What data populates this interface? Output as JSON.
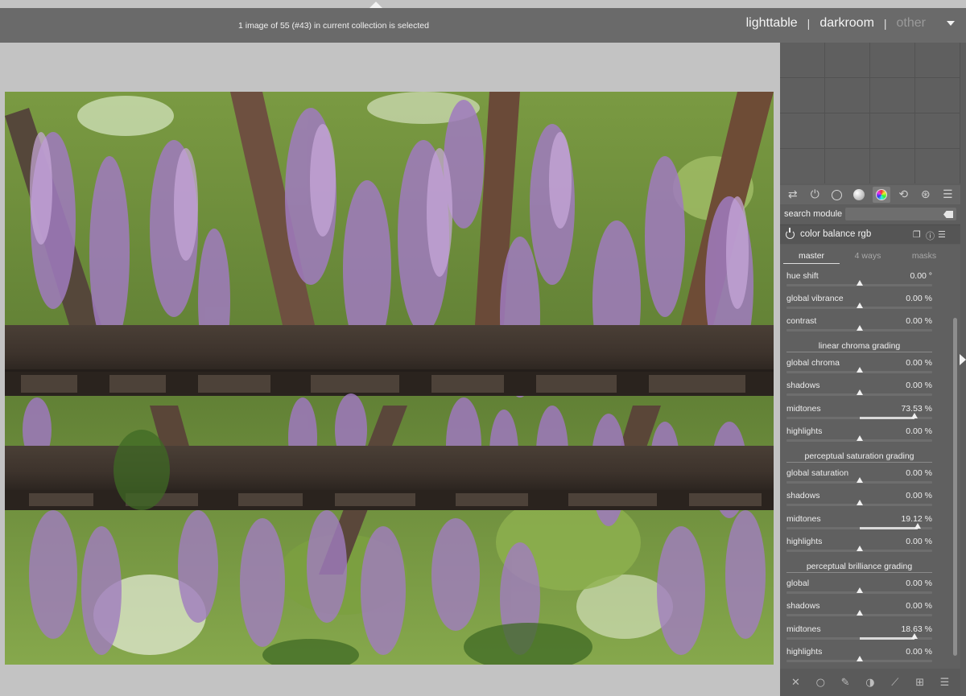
{
  "header": {
    "selection_info": "1 image of 55 (#43) in current collection is selected",
    "views": {
      "lighttable": "lighttable",
      "darkroom": "darkroom",
      "other": "other"
    },
    "separator": "|"
  },
  "module_groups": [
    {
      "icon": "sliders-icon",
      "glyph": "⇄"
    },
    {
      "icon": "power-icon",
      "glyph": "⏻"
    },
    {
      "icon": "ring-icon",
      "glyph": ""
    },
    {
      "icon": "sphere-icon",
      "glyph": ""
    },
    {
      "icon": "color-wheel-icon",
      "glyph": "",
      "active": true
    },
    {
      "icon": "circle-arrows-icon",
      "glyph": "⟲"
    },
    {
      "icon": "aperture-icon",
      "glyph": "⊛"
    },
    {
      "icon": "hamburger-icon",
      "glyph": "☰"
    }
  ],
  "search": {
    "label": "search module",
    "value": "",
    "placeholder": ""
  },
  "module": {
    "title": "color balance rgb",
    "tabs": [
      "master",
      "4 ways",
      "masks"
    ],
    "active_tab": "master"
  },
  "controls": {
    "hue_shift": {
      "label": "hue shift",
      "value": "0.00 °",
      "pos": 0.5
    },
    "global_vibrance": {
      "label": "global vibrance",
      "value": "0.00 %",
      "pos": 0.5
    },
    "contrast": {
      "label": "contrast",
      "value": "0.00 %",
      "pos": 0.5
    },
    "linear_chroma_grading": {
      "title": "linear chroma grading",
      "global_chroma": {
        "label": "global chroma",
        "value": "0.00 %",
        "pos": 0.5
      },
      "shadows": {
        "label": "shadows",
        "value": "0.00 %",
        "pos": 0.5
      },
      "midtones": {
        "label": "midtones",
        "value": "73.53 %",
        "pos": 0.88
      },
      "highlights": {
        "label": "highlights",
        "value": "0.00 %",
        "pos": 0.5
      }
    },
    "perceptual_saturation_grading": {
      "title": "perceptual saturation grading",
      "global_saturation": {
        "label": "global saturation",
        "value": "0.00 %",
        "pos": 0.5
      },
      "shadows": {
        "label": "shadows",
        "value": "0.00 %",
        "pos": 0.5
      },
      "midtones": {
        "label": "midtones",
        "value": "19.12 %",
        "pos": 0.9
      },
      "highlights": {
        "label": "highlights",
        "value": "0.00 %",
        "pos": 0.5
      }
    },
    "perceptual_brilliance_grading": {
      "title": "perceptual brilliance grading",
      "global": {
        "label": "global",
        "value": "0.00 %",
        "pos": 0.5
      },
      "shadows": {
        "label": "shadows",
        "value": "0.00 %",
        "pos": 0.5
      },
      "midtones": {
        "label": "midtones",
        "value": "18.63 %",
        "pos": 0.88
      },
      "highlights": {
        "label": "highlights",
        "value": "0.00 %",
        "pos": 0.5
      }
    }
  },
  "bottom_toolbar": [
    {
      "icon": "close-icon",
      "glyph": "✕"
    },
    {
      "icon": "circle-icon",
      "glyph": "○"
    },
    {
      "icon": "brush-icon",
      "glyph": "✎"
    },
    {
      "icon": "drawn-parametric-icon",
      "glyph": "◑"
    },
    {
      "icon": "parametric-mask-icon",
      "glyph": "⟋"
    },
    {
      "icon": "raster-mask-icon",
      "glyph": "⊞"
    },
    {
      "icon": "menu-icon",
      "glyph": "☰"
    }
  ]
}
